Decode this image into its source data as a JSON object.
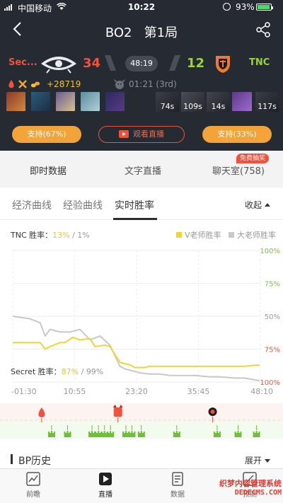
{
  "status_bar": {
    "carrier": "中国移动",
    "time": "10:22",
    "battery": "93%"
  },
  "nav": {
    "title": "BO2   第1局"
  },
  "match": {
    "left_team": {
      "name": "Sec...",
      "kills": "34",
      "color": "#f0523c"
    },
    "right_team": {
      "name": "TNC",
      "kills": "12",
      "color": "#9bd43a"
    },
    "game_time": "48:19",
    "gold_lead": "+28719",
    "roshan_time": "01:21 (3rd)",
    "dead_timers": [
      "74s",
      "109s",
      "14s",
      "117s"
    ],
    "support_left": "支持(67%)",
    "support_right": "支持(33%)",
    "watch_live": "观看直播"
  },
  "tabs": {
    "realtime": "即时数据",
    "text_live": "文字直播",
    "chatroom": "聊天室(758)",
    "chat_badge": "免费抽奖"
  },
  "subtabs": {
    "economy": "经济曲线",
    "experience": "经验曲线",
    "winrate": "实时胜率",
    "collapse": "收起"
  },
  "winrate_panel": {
    "tnc_label": "TNC 胜率：",
    "tnc_v": "13%",
    "tnc_sep": " / ",
    "tnc_d": "1%",
    "legend_v": "V老师胜率",
    "legend_d": "大老师胜率",
    "secret_label": "Secret 胜率：",
    "secret_v": "87%",
    "secret_sep": " / ",
    "secret_d": "99%"
  },
  "chart_data": {
    "type": "line",
    "x_ticks": [
      "-01:30",
      "10:55",
      "23:20",
      "35:45",
      "48:10"
    ],
    "y_ticks_top": [
      "100%",
      "75%",
      "50%"
    ],
    "y_ticks_bottom": [
      "75%",
      "100%"
    ],
    "x_range": [
      -1.5,
      48.17
    ],
    "y_range_tnc_winrate": [
      0,
      100
    ],
    "series": [
      {
        "name": "V老师胜率",
        "color": "#f5d432",
        "x": [
          -1.5,
          2,
          4,
          5,
          6,
          8,
          9,
          10.5,
          12,
          14,
          15,
          17,
          18,
          20,
          21,
          22,
          23,
          25,
          26,
          28,
          30,
          32,
          35,
          38,
          40,
          43,
          45,
          48
        ],
        "y": [
          30,
          30,
          30,
          25,
          27,
          30,
          30,
          34,
          32,
          33,
          27,
          28,
          27,
          15,
          14,
          13,
          11,
          11,
          12,
          12,
          12,
          12,
          12,
          12,
          12,
          12,
          12,
          13
        ]
      },
      {
        "name": "大老师胜率",
        "color": "#c8c8c8",
        "x": [
          -1.5,
          2,
          4,
          5,
          6,
          8,
          10,
          12,
          14,
          16,
          18,
          19,
          20,
          21,
          22,
          24,
          26,
          28,
          30,
          32,
          35,
          38,
          40,
          43,
          45,
          48
        ],
        "y": [
          50,
          48,
          45,
          35,
          40,
          38,
          38,
          40,
          32,
          35,
          28,
          20,
          12,
          10,
          9,
          7,
          6,
          6,
          5,
          5,
          5,
          4,
          4,
          3,
          3,
          1
        ]
      }
    ],
    "events": {
      "first_blood_x": 4.3,
      "roshan_x": [
        19.6
      ],
      "bomb_x": [
        38.6
      ],
      "tower_x": [
        6.3,
        9.5,
        14.4,
        15.7,
        16.9,
        18.1,
        21.2,
        22.4,
        24.3,
        31.4,
        39.5,
        43.7,
        47.4
      ]
    },
    "xlabel": "",
    "ylabel": ""
  },
  "bp": {
    "title": "BP历史",
    "expand": "展开"
  },
  "tabbar": {
    "preview": "前瞻",
    "live": "直播",
    "data": "数据",
    "forecast": "预测"
  },
  "watermark": {
    "line1": "织梦内容管理系统",
    "line2": "DEDECMS.COM"
  },
  "colors": {
    "dark_bg": "#262b33",
    "accent_orange": "#f2a43a",
    "red": "#f0523c",
    "green": "#9bd43a",
    "yellow": "#f2c230"
  }
}
